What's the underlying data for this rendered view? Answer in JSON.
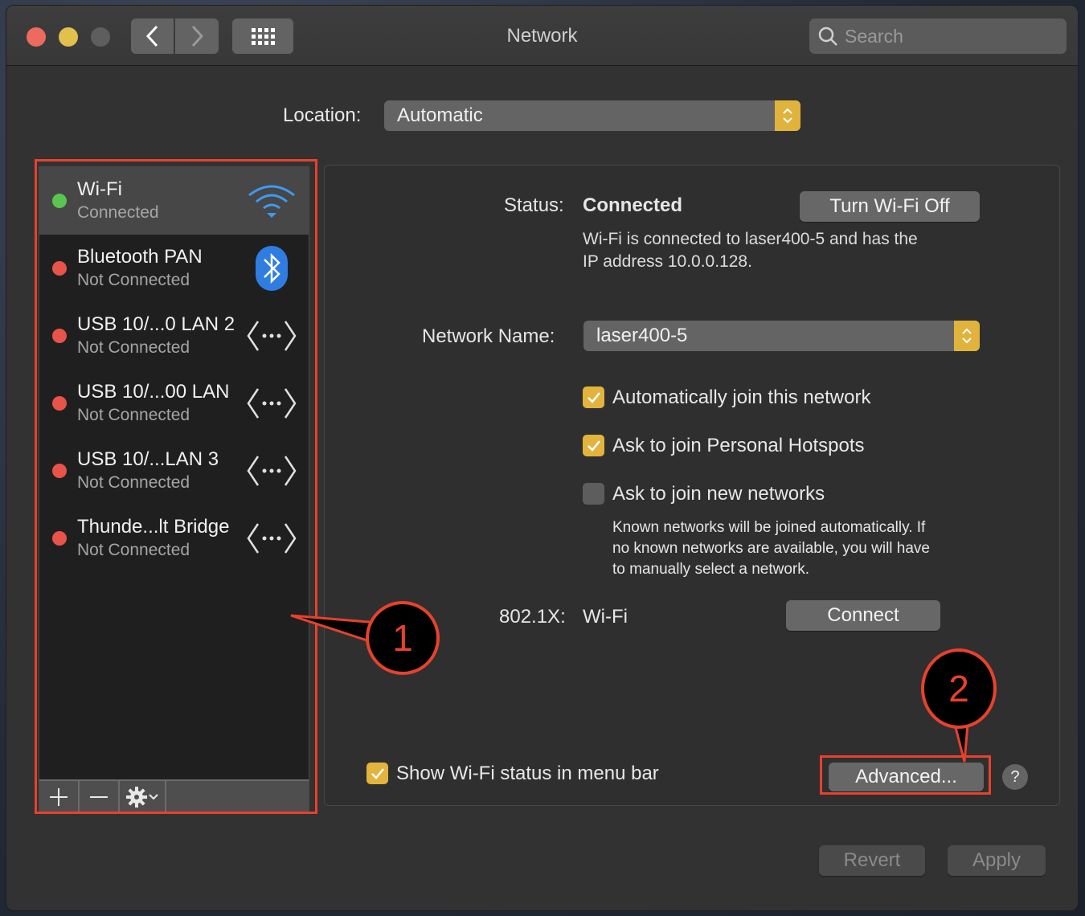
{
  "window": {
    "title": "Network",
    "search_placeholder": "Search"
  },
  "location": {
    "label": "Location:",
    "value": "Automatic"
  },
  "services": [
    {
      "name": "Wi-Fi",
      "status": "Connected",
      "status_color": "#5ac54f",
      "icon": "wifi-icon",
      "selected": true
    },
    {
      "name": "Bluetooth PAN",
      "status": "Not Connected",
      "status_color": "#e8534a",
      "icon": "bluetooth-icon",
      "selected": false
    },
    {
      "name": "USB 10/...0 LAN 2",
      "status": "Not Connected",
      "status_color": "#e8534a",
      "icon": "ethernet-icon",
      "selected": false
    },
    {
      "name": "USB 10/...00 LAN",
      "status": "Not Connected",
      "status_color": "#e8534a",
      "icon": "ethernet-icon",
      "selected": false
    },
    {
      "name": "USB 10/...LAN 3",
      "status": "Not Connected",
      "status_color": "#e8534a",
      "icon": "ethernet-icon",
      "selected": false
    },
    {
      "name": "Thunde...lt Bridge",
      "status": "Not Connected",
      "status_color": "#e8534a",
      "icon": "ethernet-icon",
      "selected": false
    }
  ],
  "sidebar_toolbar": {
    "add": "+",
    "remove": "—"
  },
  "detail": {
    "status_label": "Status:",
    "status_value": "Connected",
    "turn_off_button": "Turn Wi-Fi Off",
    "status_desc_line1": "Wi-Fi is connected to laser400-5 and has the",
    "status_desc_line2": "IP address 10.0.0.128.",
    "network_name_label": "Network Name:",
    "network_name_value": "laser400-5",
    "checkboxes": [
      {
        "label": "Automatically join this network",
        "checked": true
      },
      {
        "label": "Ask to join Personal Hotspots",
        "checked": true
      },
      {
        "label": "Ask to join new networks",
        "checked": false
      }
    ],
    "known_networks_line1": "Known networks will be joined automatically. If",
    "known_networks_line2": "no known networks are available, you will have",
    "known_networks_line3": "to manually select a network.",
    "dot1x_label": "802.1X:",
    "dot1x_value": "Wi-Fi",
    "connect_button": "Connect",
    "show_status_label": "Show Wi-Fi status in menu bar",
    "show_status_checked": true,
    "advanced_button": "Advanced...",
    "help": "?"
  },
  "footer": {
    "revert_button": "Revert",
    "apply_button": "Apply"
  },
  "annotations": {
    "callout1": "1",
    "callout2": "2",
    "color": "#e8412c"
  }
}
